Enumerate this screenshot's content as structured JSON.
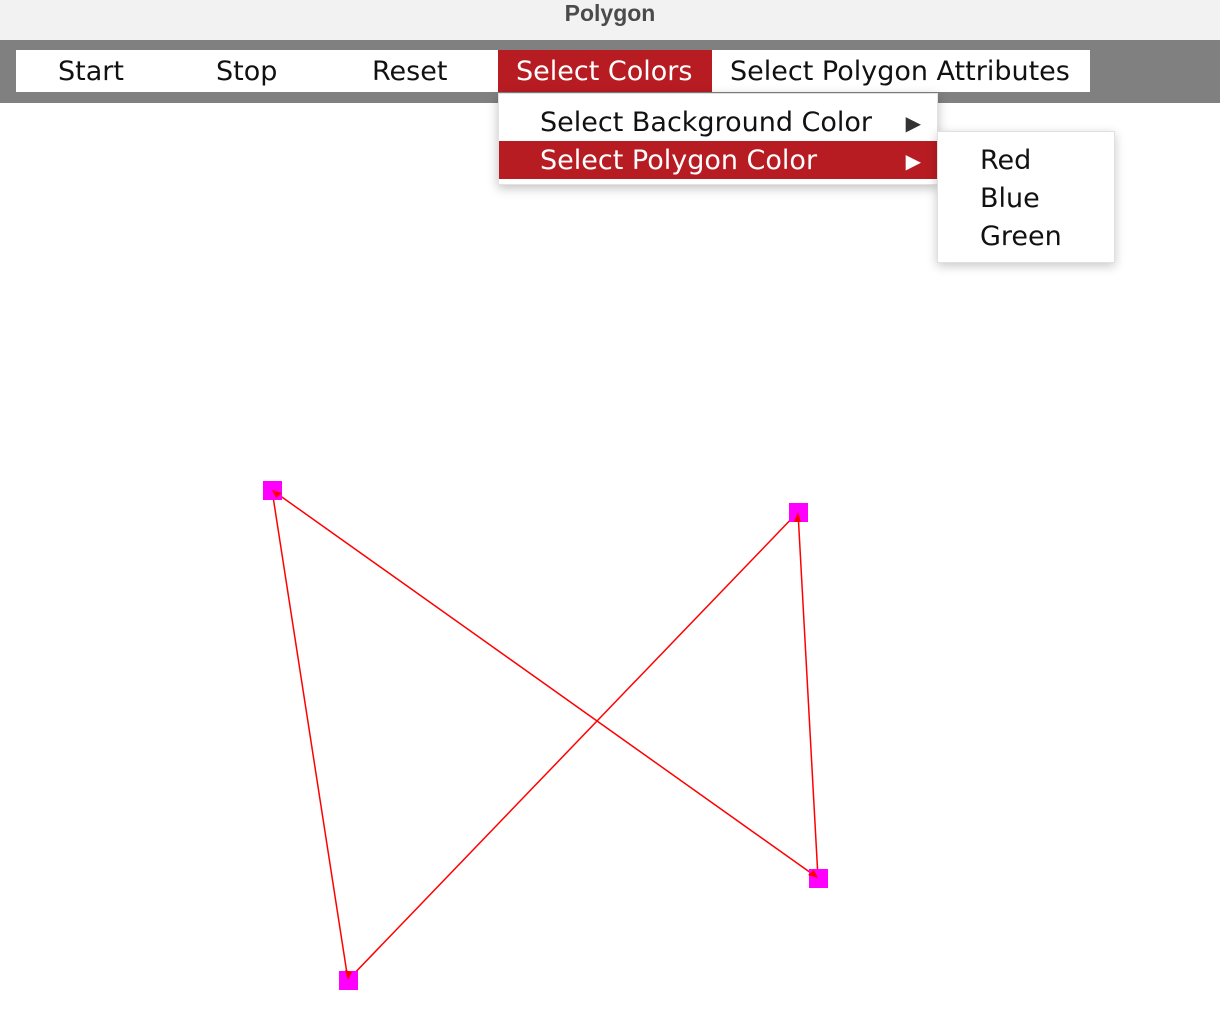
{
  "window": {
    "title": "Polygon"
  },
  "menubar": {
    "items": [
      {
        "label": "Start"
      },
      {
        "label": "Stop"
      },
      {
        "label": "Reset"
      },
      {
        "label": "Select Colors"
      },
      {
        "label": "Select Polygon Attributes"
      }
    ],
    "active_index": 3
  },
  "colors_menu": {
    "items": [
      {
        "label": "Select Background Color",
        "arrow": "▶"
      },
      {
        "label": "Select Polygon Color",
        "arrow": "▶"
      }
    ],
    "highlighted_index": 1
  },
  "polygon_color_submenu": {
    "items": [
      {
        "label": "Red"
      },
      {
        "label": "Blue"
      },
      {
        "label": "Green"
      }
    ]
  },
  "theme": {
    "highlight": "#b81c23",
    "menubar_band": "#808080",
    "polygon_stroke": "#ff0000",
    "vertex_fill": "#ff00ff"
  },
  "polygon": {
    "vertex_count": 4
  }
}
